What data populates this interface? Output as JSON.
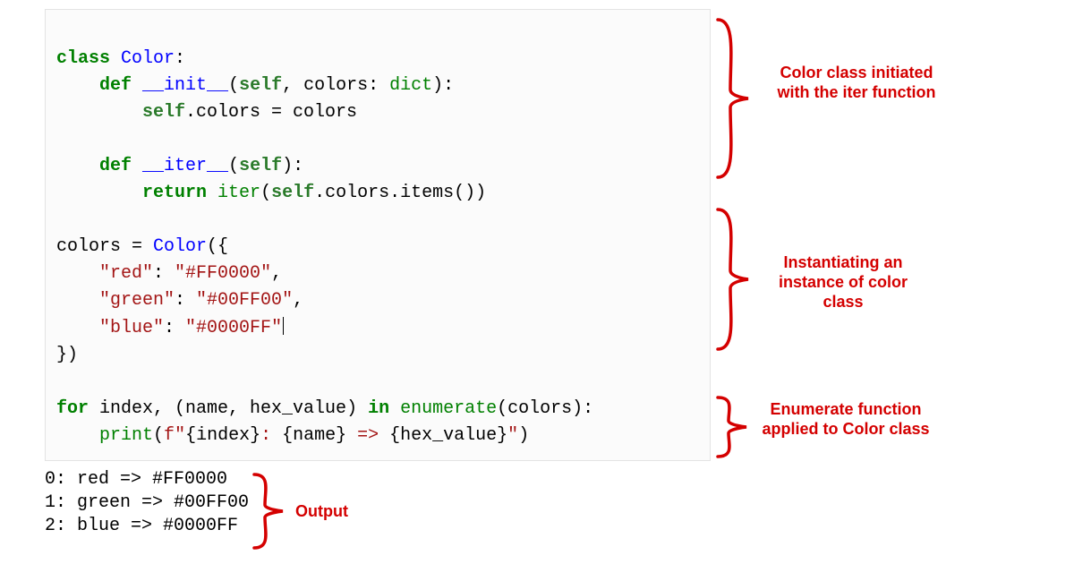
{
  "code": {
    "l01_kw_class": "class",
    "l01_cls": "Color",
    "l01_colon": ":",
    "l02_indent": "    ",
    "l02_kw_def": "def",
    "l02_fn": "__init__",
    "l02_sig_open": "(",
    "l02_self": "self",
    "l02_sig_mid": ", colors: ",
    "l02_dict": "dict",
    "l02_sig_close": "):",
    "l03_indent": "        ",
    "l03_self": "self",
    "l03_rest": ".colors = colors",
    "l04_blank": "",
    "l05_indent": "    ",
    "l05_kw_def": "def",
    "l05_fn": "__iter__",
    "l05_sig_open": "(",
    "l05_self": "self",
    "l05_sig_close": "):",
    "l06_indent": "        ",
    "l06_kw_return": "return",
    "l06_sp": " ",
    "l06_iter": "iter",
    "l06_open": "(",
    "l06_self": "self",
    "l06_rest": ".colors.items())",
    "l07_blank": "",
    "l08_a": "colors = ",
    "l08_cls": "Color",
    "l08_b": "({",
    "l09_indent": "    ",
    "l09_k": "\"red\"",
    "l09_sep": ": ",
    "l09_v": "\"#FF0000\"",
    "l09_c": ",",
    "l10_indent": "    ",
    "l10_k": "\"green\"",
    "l10_sep": ": ",
    "l10_v": "\"#00FF00\"",
    "l10_c": ",",
    "l11_indent": "    ",
    "l11_k": "\"blue\"",
    "l11_sep": ": ",
    "l11_v": "\"#0000FF\"",
    "l12": "})",
    "l13_blank": "",
    "l14_kw_for": "for",
    "l14_a": " index, (name, hex_value) ",
    "l14_kw_in": "in",
    "l14_sp": " ",
    "l14_enum": "enumerate",
    "l14_b": "(colors):",
    "l15_indent": "    ",
    "l15_print": "print",
    "l15_open": "(",
    "l15_fpre": "f",
    "l15_q1": "\"",
    "l15_s1": "{index}",
    "l15_s2": ": ",
    "l15_s3": "{name}",
    "l15_s4": " => ",
    "l15_s5": "{hex_value}",
    "l15_q2": "\"",
    "l15_close": ")"
  },
  "output": {
    "l1": "0: red => #FF0000",
    "l2": "1: green => #00FF00",
    "l3": "2: blue => #0000FF"
  },
  "annotations": {
    "a1": "Color class initiated with the iter function",
    "a2": "Instantiating an instance of color class",
    "a3": "Enumerate function applied to Color class",
    "a4": "Output"
  },
  "colors": {
    "accent": "#d40000",
    "keyword": "#008000",
    "classname": "#0000ff",
    "string": "#a31515"
  }
}
